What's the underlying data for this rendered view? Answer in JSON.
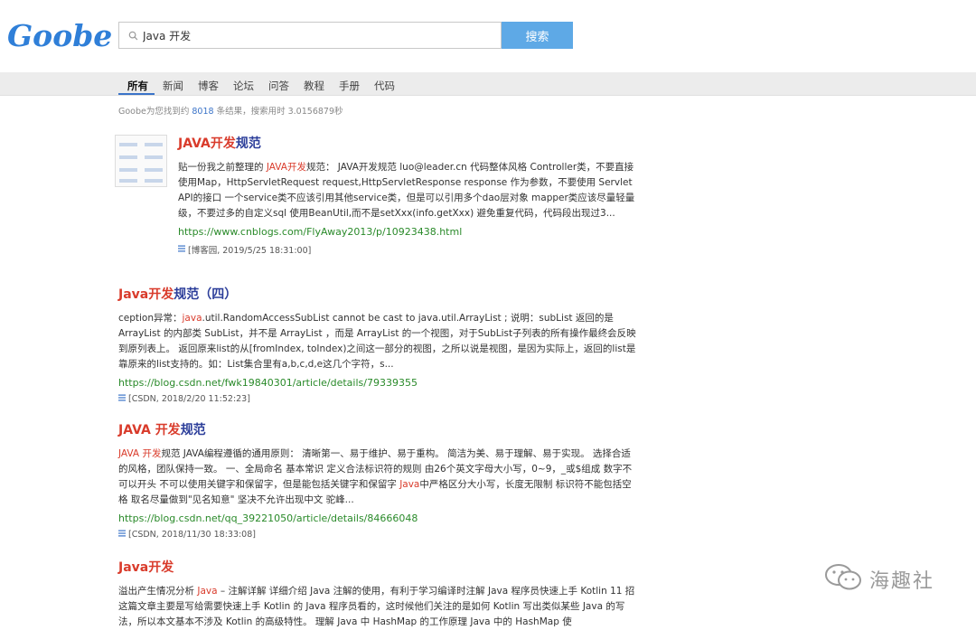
{
  "logo": "Goobe",
  "search": {
    "query": "Java 开发",
    "button": "搜索"
  },
  "nav": {
    "tabs": [
      "所有",
      "新闻",
      "博客",
      "论坛",
      "问答",
      "教程",
      "手册",
      "代码"
    ]
  },
  "stats": {
    "prefix": "Goobe为您找到约 ",
    "count": "8018",
    "suffix": " 条结果，搜索用时 3.0156879秒"
  },
  "results": [
    {
      "title_hl": "JAVA开发",
      "title_rest": "规范",
      "body_pre": "贴一份我之前整理的 ",
      "body_hl": "JAVA开发",
      "body_post": "规范： JAVA开发规范 luo@leader.cn 代码整体风格 Controller类，不要直接使用Map，HttpServletRequest request,HttpServletResponse response 作为参数，不要使用 Servlet API的接口 一个service类不应该引用其他service类，但是可以引用多个dao层对象 mapper类应该尽量轻量级，不要过多的自定义sql 使用BeanUtil,而不是setXxx(info.getXxx) 避免重复代码，代码段出现过3...",
      "url": "https://www.cnblogs.com/FlyAway2013/p/10923438.html",
      "meta": "[博客园, 2019/5/25 18:31:00]"
    },
    {
      "title_hl": "Java开发",
      "title_rest": "规范（四）",
      "body_pre": "ception异常：",
      "body_hl": "java",
      "body_post": ".util.RandomAccessSubList cannot be cast to java.util.ArrayList ; 说明：subList 返回的是 ArrayList 的内部类 SubList，并不是 ArrayList ，而是 ArrayList 的一个视图，对于SubList子列表的所有操作最终会反映到原列表上。 返回原来list的从[fromIndex, toIndex)之间这一部分的视图，之所以说是视图，是因为实际上，返回的list是靠原来的list支持的。如：List集合里有a,b,c,d,e这几个字符，s...",
      "url": "https://blog.csdn.net/fwk19840301/article/details/79339355",
      "meta": "[CSDN, 2018/2/20 11:52:23]"
    },
    {
      "title_hl": "JAVA 开发",
      "title_rest": "规范",
      "body_pre": "",
      "body_hl": "JAVA 开发",
      "body_mid": "规范 JAVA编程遵循的通用原则： 清晰第一、易于维护、易于重构。 简洁为美、易于理解、易于实现。 选择合适的风格，团队保持一致。 一、全局命名 基本常识 定义合法标识符的规则 由26个英文字母大小写，0~9，_或$组成 数字不可以开头 不可以使用关键字和保留字，但是能包括关键字和保留字 ",
      "body_hl2": "Java",
      "body_post": "中严格区分大小写，长度无限制 标识符不能包括空格 取名尽量做到\"见名知意\" 坚决不允许出现中文 驼峰...",
      "url": "https://blog.csdn.net/qq_39221050/article/details/84666048",
      "meta": "[CSDN, 2018/11/30 18:33:08]"
    },
    {
      "title_hl": "Java开发",
      "body_pre": "溢出产生情况分析 ",
      "body_hl": "Java",
      "body_post": " – 注解详解 详细介绍 Java 注解的使用，有利于学习编译时注解 Java 程序员快速上手 Kotlin 11 招 这篇文章主要是写给需要快速上手 Kotlin 的 Java 程序员看的，这时候他们关注的是如何 Kotlin 写出类似某些 Java 的写法，所以本文基本不涉及 Kotlin 的高级特性。 理解 Java 中 HashMap 的工作原理 Java 中的 HashMap 使"
    }
  ],
  "watermark": "海趣社",
  "colors": {
    "accent": "#5ea9e6",
    "title": "#2c3e9a",
    "highlight": "#d93b2b",
    "url": "#2a8a2a"
  }
}
